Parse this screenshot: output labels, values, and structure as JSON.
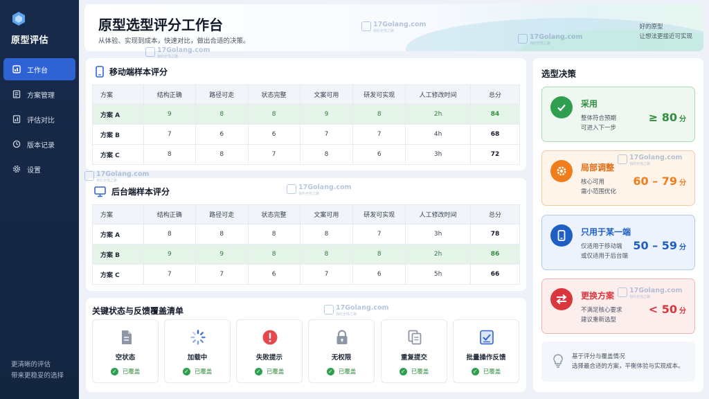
{
  "sidebar": {
    "brand": "原型评估",
    "items": [
      {
        "label": "工作台",
        "icon": "dashboard-icon",
        "active": true
      },
      {
        "label": "方案管理",
        "icon": "document-list-icon"
      },
      {
        "label": "评估对比",
        "icon": "compare-icon"
      },
      {
        "label": "版本记录",
        "icon": "history-icon"
      },
      {
        "label": "设置",
        "icon": "gear-icon"
      }
    ],
    "footer": [
      "更清晰的评估",
      "带来更稳妥的选择"
    ]
  },
  "header": {
    "title": "原型选型评分工作台",
    "subtitle": "从体验、实现到成本，快速对比，做出合适的决策。",
    "note": [
      "好的原型",
      "让想法更接近可实现"
    ]
  },
  "mobile": {
    "title": "移动端样本评分",
    "columns": [
      "方案",
      "结构正确",
      "路径可走",
      "状态完整",
      "文案可用",
      "研发可实现",
      "人工修改时间",
      "总分"
    ],
    "rows": [
      [
        "方案 A",
        "9",
        "8",
        "8",
        "9",
        "8",
        "2h",
        "84"
      ],
      [
        "方案 B",
        "7",
        "6",
        "6",
        "7",
        "7",
        "4h",
        "68"
      ],
      [
        "方案 C",
        "8",
        "8",
        "7",
        "8",
        "6",
        "3h",
        "72"
      ]
    ],
    "highlight_row": 0
  },
  "backend": {
    "title": "后台端样本评分",
    "columns": [
      "方案",
      "结构正确",
      "路径可走",
      "状态完整",
      "文案可用",
      "研发可实现",
      "人工修改时间",
      "总分"
    ],
    "rows": [
      [
        "方案 A",
        "8",
        "8",
        "8",
        "8",
        "7",
        "3h",
        "78"
      ],
      [
        "方案 B",
        "9",
        "9",
        "8",
        "8",
        "8",
        "2h",
        "86"
      ],
      [
        "方案 C",
        "7",
        "7",
        "6",
        "7",
        "6",
        "5h",
        "66"
      ]
    ],
    "highlight_row": 1
  },
  "coverage": {
    "title": "关键状态与反馈覆盖清单",
    "items": [
      {
        "label": "空状态",
        "status": "已覆盖",
        "icon": "empty-file-icon"
      },
      {
        "label": "加载中",
        "status": "已覆盖",
        "icon": "loading-spinner-icon"
      },
      {
        "label": "失败提示",
        "status": "已覆盖",
        "icon": "error-alert-icon"
      },
      {
        "label": "无权限",
        "status": "已覆盖",
        "icon": "lock-icon"
      },
      {
        "label": "重复提交",
        "status": "已覆盖",
        "icon": "duplicate-icon"
      },
      {
        "label": "批量操作反馈",
        "status": "已覆盖",
        "icon": "checklist-icon"
      }
    ]
  },
  "decision": {
    "title": "选型决策",
    "cards": [
      {
        "name": "采用",
        "desc": [
          "整体符合预期",
          "可进入下一步"
        ],
        "score": "≥ 80",
        "unit": "分",
        "color": "#2f9e4f",
        "icon": "check-icon"
      },
      {
        "name": "局部调整",
        "desc": [
          "核心可用",
          "需小范围优化"
        ],
        "score": "60 – 79",
        "unit": "分",
        "color": "#f07d1a",
        "icon": "gear-icon"
      },
      {
        "name": "只用于某一端",
        "desc": [
          "仅适用于移动端",
          "或仅适用于后台端"
        ],
        "score": "50 – 59",
        "unit": "分",
        "color": "#1f5fc4",
        "icon": "mobile-icon"
      },
      {
        "name": "更换方案",
        "desc": [
          "不满足核心要求",
          "建议重新选型"
        ],
        "score": "< 50",
        "unit": "分",
        "color": "#d9363e",
        "icon": "swap-icon"
      }
    ],
    "tip": [
      "基于评分与覆盖情况",
      "选择最合适的方案，平衡体验与实现成本。"
    ]
  },
  "watermark": {
    "text": "17Golang.com",
    "sub": "我的全栈之路"
  }
}
